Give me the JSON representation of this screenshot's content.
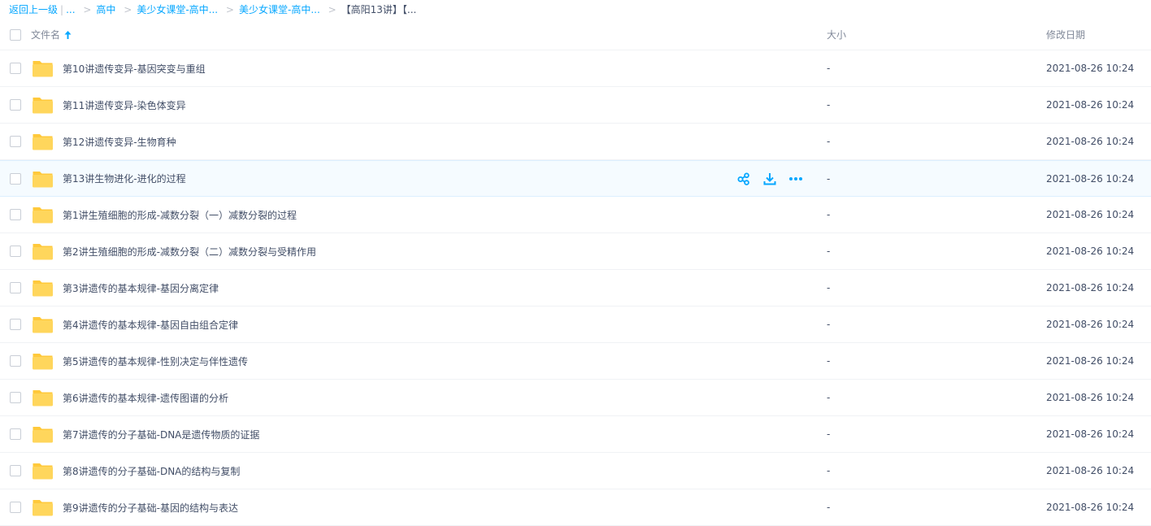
{
  "breadcrumb": {
    "back": "返回上一级",
    "bar": "|",
    "ellipsis": "...",
    "sep": ">",
    "crumbs": [
      "高中",
      "美少女课堂-高中...",
      "美少女课堂-高中..."
    ],
    "current": "【高阳13讲】【..."
  },
  "table": {
    "columns": {
      "name": "文件名",
      "size": "大小",
      "date": "修改日期"
    },
    "rows": [
      {
        "name": "第10讲遗传变异-基因突变与重组",
        "size": "-",
        "date": "2021-08-26 10:24"
      },
      {
        "name": "第11讲遗传变异-染色体变异",
        "size": "-",
        "date": "2021-08-26 10:24"
      },
      {
        "name": "第12讲遗传变异-生物育种",
        "size": "-",
        "date": "2021-08-26 10:24"
      },
      {
        "name": "第13讲生物进化-进化的过程",
        "size": "-",
        "date": "2021-08-26 10:24"
      },
      {
        "name": "第1讲生殖细胞的形成-减数分裂（一）减数分裂的过程",
        "size": "-",
        "date": "2021-08-26 10:24"
      },
      {
        "name": "第2讲生殖细胞的形成-减数分裂（二）减数分裂与受精作用",
        "size": "-",
        "date": "2021-08-26 10:24"
      },
      {
        "name": "第3讲遗传的基本规律-基因分离定律",
        "size": "-",
        "date": "2021-08-26 10:24"
      },
      {
        "name": "第4讲遗传的基本规律-基因自由组合定律",
        "size": "-",
        "date": "2021-08-26 10:24"
      },
      {
        "name": "第5讲遗传的基本规律-性别决定与伴性遗传",
        "size": "-",
        "date": "2021-08-26 10:24"
      },
      {
        "name": "第6讲遗传的基本规律-遗传图谱的分析",
        "size": "-",
        "date": "2021-08-26 10:24"
      },
      {
        "name": "第7讲遗传的分子基础-DNA是遗传物质的证据",
        "size": "-",
        "date": "2021-08-26 10:24"
      },
      {
        "name": "第8讲遗传的分子基础-DNA的结构与复制",
        "size": "-",
        "date": "2021-08-26 10:24"
      },
      {
        "name": "第9讲遗传的分子基础-基因的结构与表达",
        "size": "-",
        "date": "2021-08-26 10:24"
      }
    ]
  },
  "icons": {
    "folder": "folder-icon",
    "sort": "sort-ascending-icon",
    "actions": [
      "share-icon",
      "download-icon",
      "more-icon"
    ]
  },
  "colors": {
    "accent": "#06a7ff",
    "folder": "#ffd54f",
    "hover_row": "#f5fbff",
    "text": "#424e67"
  }
}
